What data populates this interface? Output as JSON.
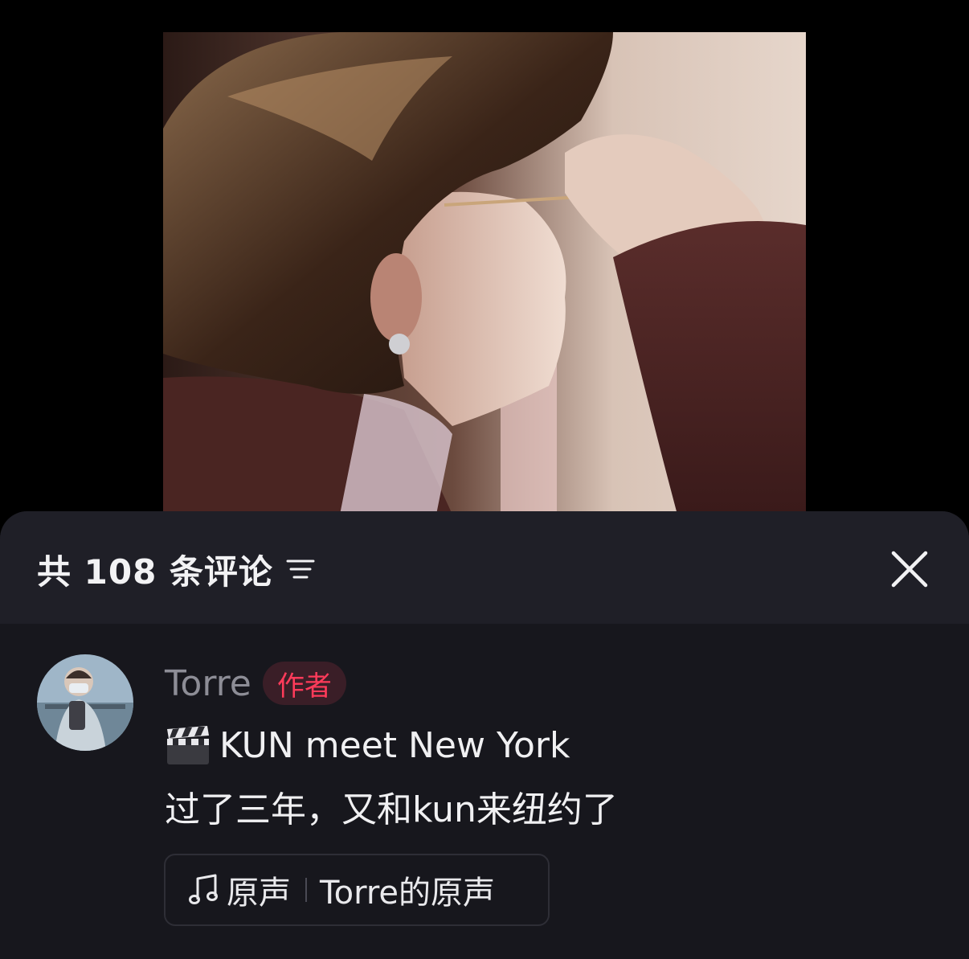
{
  "video": {
    "description_icon": "video-frame"
  },
  "comments_panel": {
    "title": "共 108 条评论",
    "sort_icon": "sort-icon",
    "close_icon": "close-icon"
  },
  "comment": {
    "author": "Torre",
    "badge": "作者",
    "line1_icon": "clapper-board-icon",
    "line1_text": "KUN meet New York",
    "line2_text": "过了三年，又和kun来纽约了",
    "music": {
      "icon": "music-note-icon",
      "label": "原声",
      "title": "Torre的原声"
    }
  },
  "colors": {
    "sheet_background": "#17171d",
    "header_background": "#1f1f27",
    "badge_text": "#ff3b5a",
    "badge_background": "#3a1e27",
    "author_text": "#8d8d96"
  }
}
